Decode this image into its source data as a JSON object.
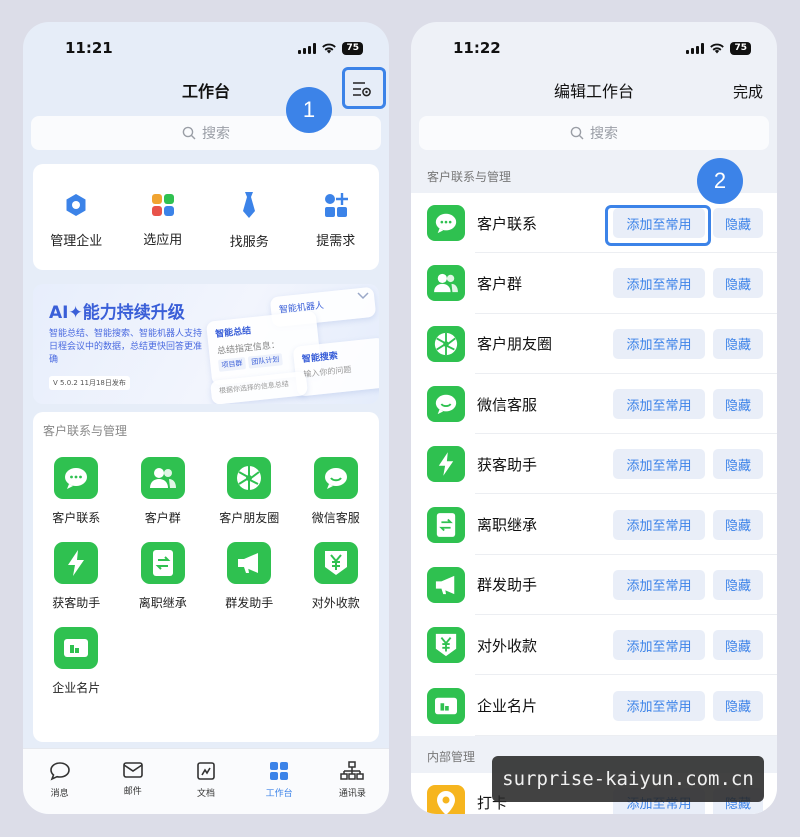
{
  "left": {
    "status": {
      "time": "11:21",
      "battery": "75"
    },
    "title": "工作台",
    "search_placeholder": "搜索",
    "step_badge": "1",
    "quick_actions": [
      {
        "label": "管理企业",
        "icon": "hexagon-icon"
      },
      {
        "label": "选应用",
        "icon": "app-grid-icon"
      },
      {
        "label": "找服务",
        "icon": "tie-icon"
      },
      {
        "label": "提需求",
        "icon": "shapes-plus-icon"
      }
    ],
    "banner": {
      "title": "AI✦能力持续升级",
      "desc": "智能总结、智能搜索、智能机器人支持日程会议中的数据，总结更快回答更准确",
      "version": "V 5.0.2   11月18日发布",
      "card1": "智能机器人",
      "card2": "智能总结",
      "card2_sub": "总结指定信息：",
      "card2_tags": [
        "项目群",
        "团队计划"
      ],
      "card3": "智能搜索",
      "card3_sub": "输入你的问题",
      "card4": "根据你选择的信息总结"
    },
    "section_title": "客户联系与管理",
    "apps": [
      "客户联系",
      "客户群",
      "客户朋友圈",
      "微信客服",
      "获客助手",
      "离职继承",
      "群发助手",
      "对外收款",
      "企业名片"
    ],
    "tabs": [
      {
        "label": "消息",
        "icon": "message-icon"
      },
      {
        "label": "邮件",
        "icon": "mail-icon"
      },
      {
        "label": "文档",
        "icon": "document-icon"
      },
      {
        "label": "工作台",
        "icon": "workbench-icon",
        "active": true
      },
      {
        "label": "通讯录",
        "icon": "contacts-icon"
      }
    ]
  },
  "right": {
    "status": {
      "time": "11:22",
      "battery": "75"
    },
    "title": "编辑工作台",
    "done": "完成",
    "search_placeholder": "搜索",
    "step_badge": "2",
    "section_title": "客户联系与管理",
    "add_label": "添加至常用",
    "hide_label": "隐藏",
    "items": [
      "客户联系",
      "客户群",
      "客户朋友圈",
      "微信客服",
      "获客助手",
      "离职继承",
      "群发助手",
      "对外收款",
      "企业名片"
    ],
    "section2_title": "内部管理",
    "section2_items": [
      "打卡"
    ]
  },
  "watermark": "surprise-kaiyun.com.cn",
  "colors": {
    "accent": "#3c83e8",
    "app_green": "#2fc150",
    "bg": "#dcdde8"
  }
}
